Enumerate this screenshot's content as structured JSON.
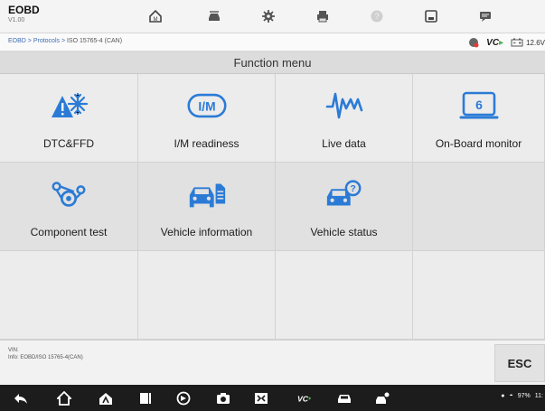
{
  "app": {
    "title": "EOBD",
    "version": "V1.00"
  },
  "toolbar": {
    "buttons": [
      {
        "icon": "home-icon"
      },
      {
        "icon": "car-change-icon"
      },
      {
        "icon": "settings-icon"
      },
      {
        "icon": "print-icon"
      },
      {
        "icon": "help-icon"
      },
      {
        "icon": "save-icon"
      },
      {
        "icon": "data-logging-icon"
      }
    ]
  },
  "breadcrumb": {
    "path": "EOBD > Protocols > ",
    "current": "ISO 15765-4 (CAN)"
  },
  "status": {
    "vci_label": "VC",
    "voltage": "12.6V"
  },
  "menu": {
    "title": "Function menu",
    "items": [
      {
        "label": "DTC&FFD",
        "icon": "dtc-ffd-icon"
      },
      {
        "label": "I/M readiness",
        "icon": "im-readiness-icon",
        "badge": "I/M"
      },
      {
        "label": "Live data",
        "icon": "live-data-icon"
      },
      {
        "label": "On-Board monitor",
        "icon": "onboard-monitor-icon",
        "badge": "6"
      },
      {
        "label": "Component test",
        "icon": "component-test-icon"
      },
      {
        "label": "Vehicle information",
        "icon": "vehicle-information-icon"
      },
      {
        "label": "Vehicle status",
        "icon": "vehicle-status-icon"
      }
    ]
  },
  "info": {
    "vin": "VIN:",
    "line": "Info: EOBD/ISO 15765-4(CAN)"
  },
  "esc_label": "ESC",
  "nav": {
    "battery": "97%",
    "time": "11:"
  },
  "colors": {
    "accent": "#2b7bd6",
    "warning": "#2b7bd6"
  }
}
